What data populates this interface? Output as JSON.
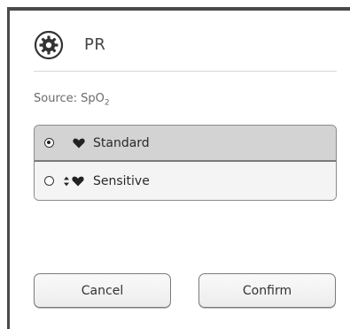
{
  "header": {
    "icon": "gear-icon",
    "title": "PR"
  },
  "source": {
    "prefix": "Source: SpO",
    "subscript": "2"
  },
  "options": [
    {
      "label": "Standard",
      "icon": "heart-icon",
      "selected": true
    },
    {
      "label": "Sensitive",
      "icon": "heart-with-arrows-icon",
      "selected": false
    }
  ],
  "buttons": {
    "cancel": "Cancel",
    "confirm": "Confirm"
  },
  "colors": {
    "selected_row": "#d3d3d3",
    "unselected_row": "#f4f4f4",
    "frame": "#4a4a4a"
  }
}
